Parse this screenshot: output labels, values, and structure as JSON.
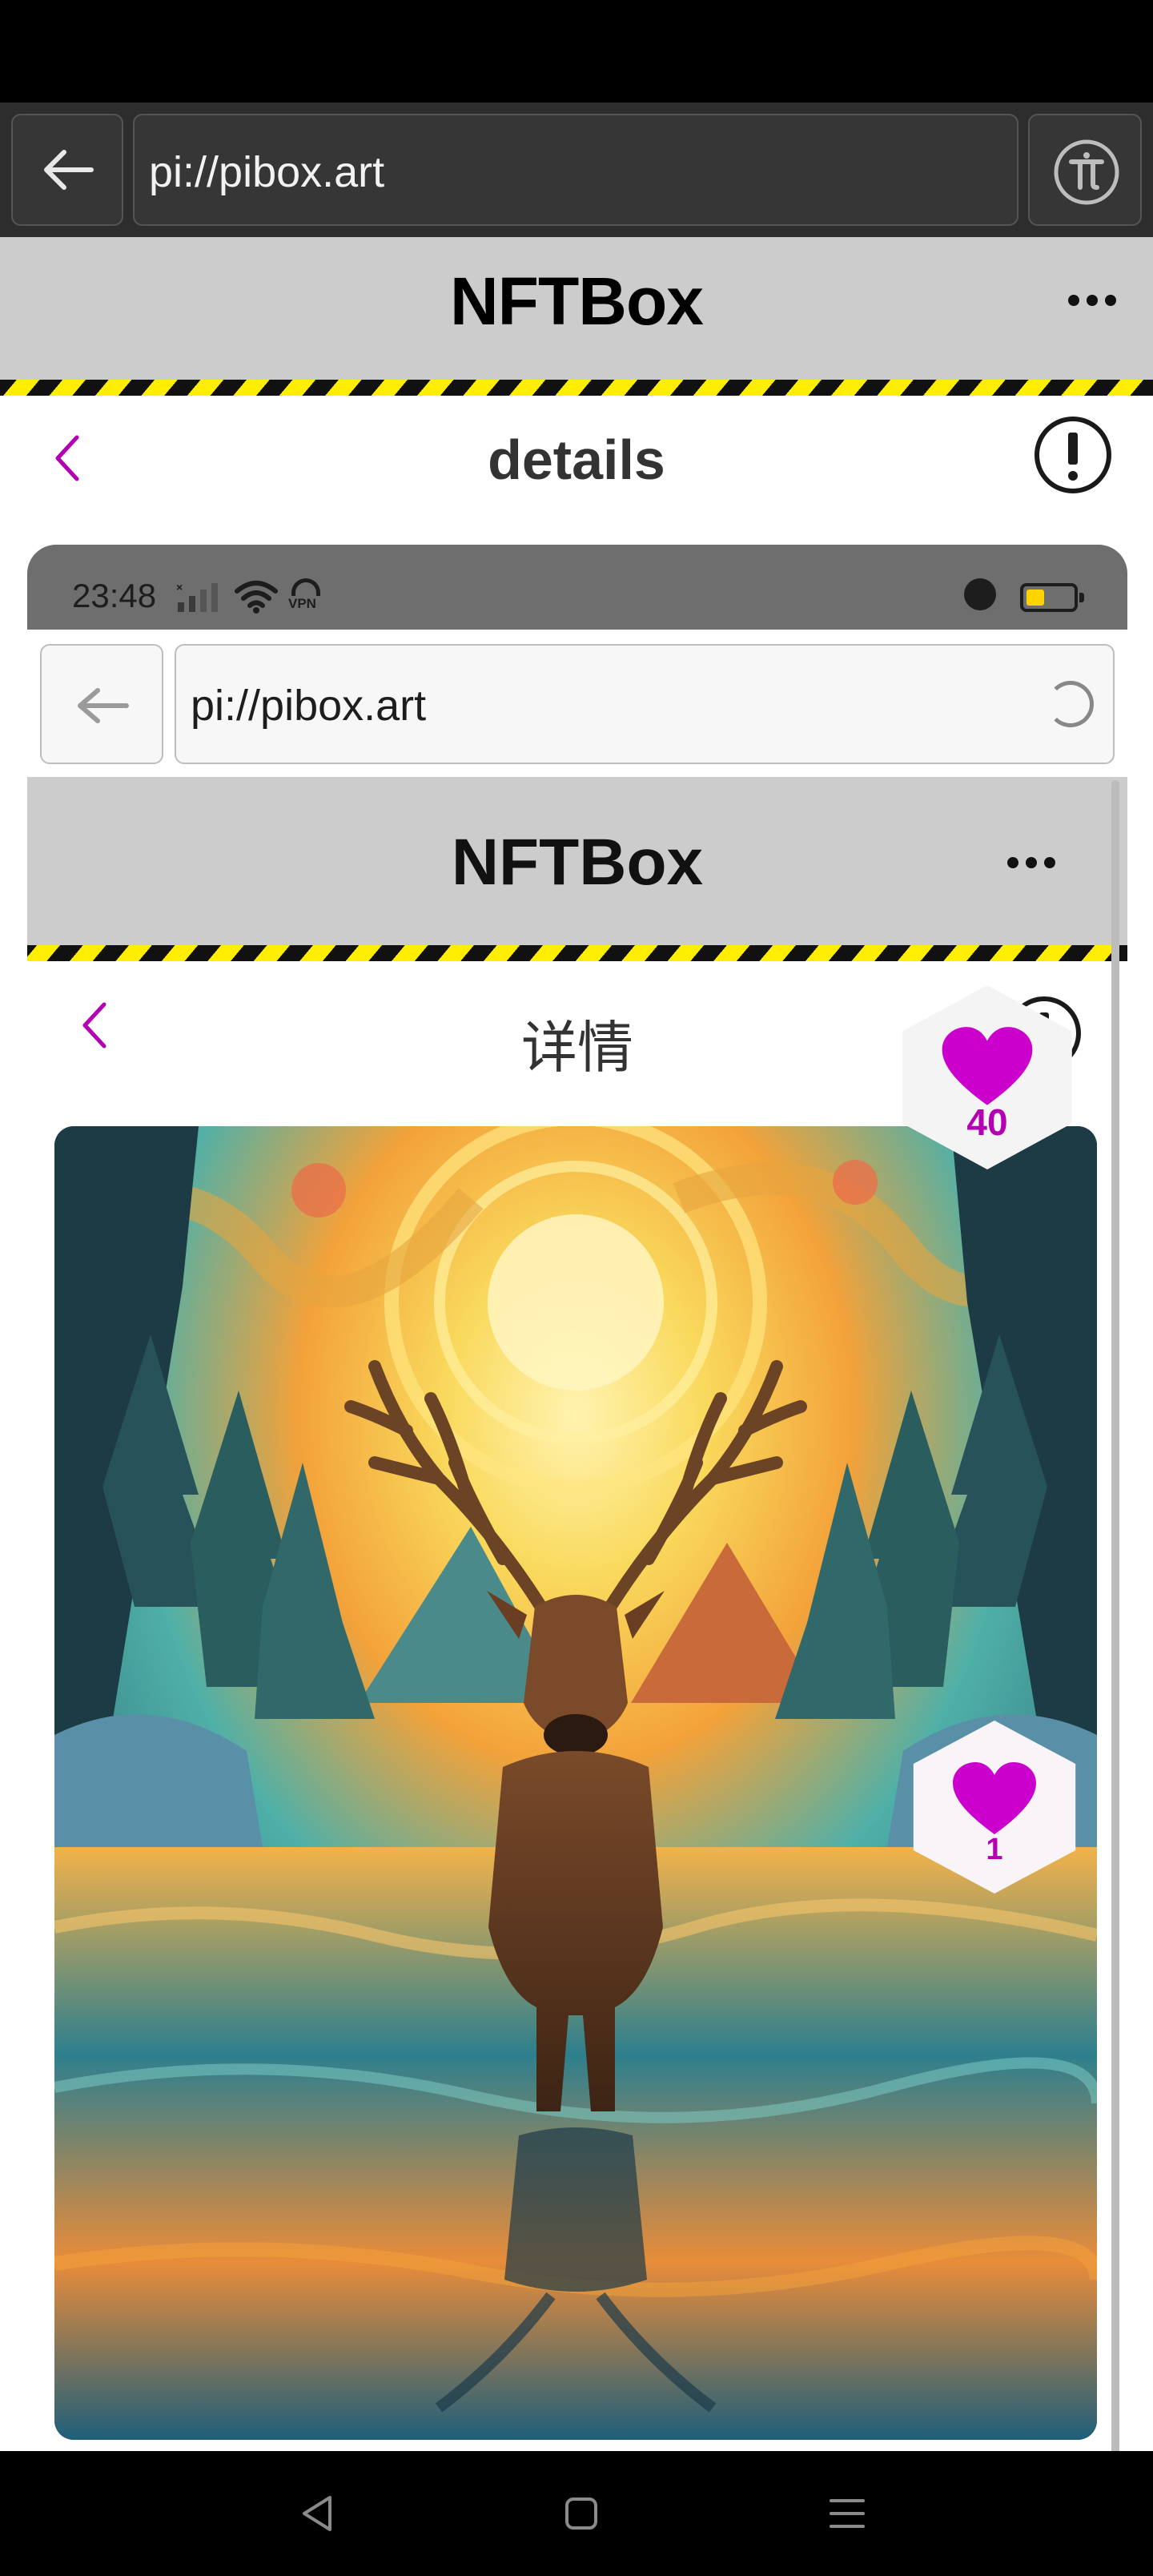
{
  "browser": {
    "url": "pi://pibox.art"
  },
  "site": {
    "title": "NFTBox"
  },
  "page": {
    "title": "details"
  },
  "likes": {
    "outer_count": "40",
    "inner_count": "1"
  },
  "screenshot": {
    "status_time": "23:48",
    "vpn_label": "VPN",
    "url": "pi://pibox.art",
    "site_title": "NFTBox",
    "nav_title": "详情"
  },
  "colors": {
    "accent": "#b300b3",
    "header_bg": "#cccccc",
    "hazard_yellow": "#ffee00"
  },
  "icons": [
    "back-arrow-icon",
    "pi-network-icon",
    "more-dots-icon",
    "chevron-left-icon",
    "info-icon",
    "heart-icon",
    "signal-icon",
    "wifi-icon",
    "vpn-icon",
    "battery-icon",
    "nav-back-icon",
    "nav-home-icon",
    "nav-menu-icon"
  ]
}
